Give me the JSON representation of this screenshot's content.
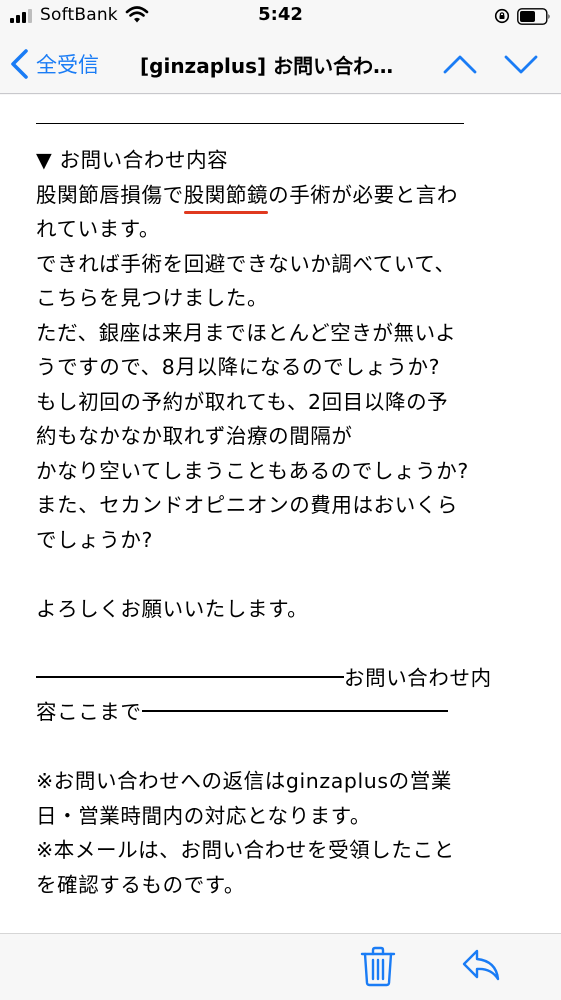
{
  "status_bar": {
    "carrier": "SoftBank",
    "time": "5:42"
  },
  "nav": {
    "back_label": "全受信",
    "title": "[ginzaplus] お問い合わ…"
  },
  "email": {
    "section_heading": "▼ お問い合わせ内容",
    "line1_before": "股関節唇損傷で",
    "line1_marked": "股関節鏡",
    "line1_after": "の手術が必要と言わ",
    "line2": "れています。",
    "line3": "できれば手術を回避できないか調べていて、",
    "line4": "こちらを見つけました。",
    "line5": "ただ、銀座は来月までほとんど空きが無いよ",
    "line6": "うですので、8月以降になるのでしょうか?",
    "line7": "もし初回の予約が取れても、2回目以降の予",
    "line8": "約もなかなか取れず治療の間隔が",
    "line9": "かなり空いてしまうこともあるのでしょうか?",
    "line10": "また、セカンドオピニオンの費用はおいくら",
    "line11": "でしょうか?",
    "greeting": "よろしくお願いいたします。",
    "end_marker_a": "お問い合わせ内",
    "end_marker_b": "容ここまで",
    "note1": "※お問い合わせへの返信はginzaplusの営業",
    "note2": "日・営業時間内の対応となります。",
    "note3": "※本メールは、お問い合わせを受領したこと",
    "note4": "を確認するものです。"
  },
  "colors": {
    "accent": "#1a7cf5",
    "underline_mark": "#e0391f"
  },
  "icons": {
    "back": "chevron-left-icon",
    "up": "chevron-up-icon",
    "down": "chevron-down-icon",
    "trash": "trash-icon",
    "reply": "reply-icon"
  }
}
